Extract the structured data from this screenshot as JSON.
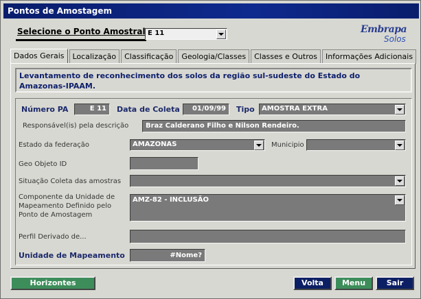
{
  "window": {
    "title": "Pontos de Amostagem"
  },
  "selector": {
    "label": "Selecione o Ponto Amostral",
    "value": "E 11"
  },
  "logo": {
    "brand": "Embrapa",
    "sub": "Solos"
  },
  "tabs": [
    {
      "label": "Dados Gerais",
      "active": true
    },
    {
      "label": "Localização",
      "active": false
    },
    {
      "label": "Classificação",
      "active": false
    },
    {
      "label": "Geologia/Classes",
      "active": false
    },
    {
      "label": "Classes e Outros",
      "active": false
    },
    {
      "label": "Informações Adicionais",
      "active": false
    }
  ],
  "description": "Levantamento de reconhecimento dos solos da região sul-sudeste do Estado do Amazonas-IPAAM.",
  "form": {
    "numero_pa": {
      "label": "Número PA",
      "value": "E 11"
    },
    "data_coleta": {
      "label": "Data de Coleta",
      "value": "01/09/99"
    },
    "tipo": {
      "label": "Tipo",
      "value": "AMOSTRA EXTRA"
    },
    "responsavel": {
      "label": "Responsável(is) pela descrição",
      "value": "Braz Calderano Filho e Nilson Rendeiro."
    },
    "estado": {
      "label": "Estado da federação",
      "value": "AMAZONAS"
    },
    "municipio": {
      "label": "Municipio",
      "value": ""
    },
    "geo_objeto": {
      "label": "Geo Objeto ID",
      "value": ""
    },
    "situacao": {
      "label": "Situação Coleta das amostras",
      "value": ""
    },
    "componente": {
      "label_lines": [
        "Componente da Unidade de",
        "Mapeamento Definido pelo",
        "Ponto de Amostagem"
      ],
      "value": "AMZ-82 - INCLUSÃO"
    },
    "perfil": {
      "label": "Perfil Derivado de...",
      "value": ""
    },
    "unidade": {
      "label": "Unidade de Mapeamento",
      "value": "#Nome?"
    }
  },
  "buttons": {
    "horizontes": "Horizontes",
    "volta": "Volta",
    "menu": "Menu",
    "sair": "Sair"
  }
}
